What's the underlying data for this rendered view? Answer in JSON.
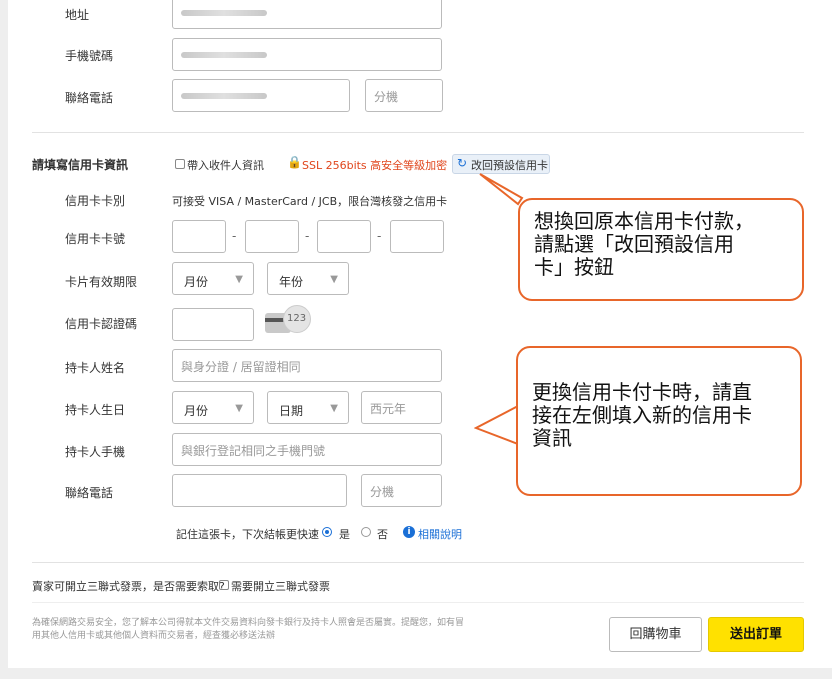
{
  "recipient": {
    "address_label": "地址",
    "mobile_label": "手機號碼",
    "phone_label": "聯絡電話",
    "extension_placeholder": "分機"
  },
  "card": {
    "section_title": "請填寫信用卡資訊",
    "import_recipient_label": "帶入收件人資訊",
    "ssl_label": "SSL 256bits 高安全等級加密",
    "restore_default_label": "改回預設信用卡",
    "type_label": "信用卡卡別",
    "type_value": "可接受 VISA / MasterCard / JCB，限台灣核發之信用卡",
    "number_label": "信用卡卡號",
    "expiry_label": "卡片有效期限",
    "month_option": "月份",
    "year_option": "年份",
    "cvv_label": "信用卡認證碼",
    "cvv_icon_text": "123",
    "holder_name_label": "持卡人姓名",
    "holder_name_placeholder": "與身分證 / 居留證相同",
    "birthday_label": "持卡人生日",
    "day_option": "日期",
    "roc_year_placeholder": "西元年",
    "holder_mobile_label": "持卡人手機",
    "holder_mobile_placeholder": "與銀行登記相同之手機門號",
    "contact_phone_label": "聯絡電話",
    "extension_placeholder": "分機",
    "remember_label": "記住這張卡，下次結帳更快速",
    "remember_yes": "是",
    "remember_no": "否",
    "help_link": "相關說明"
  },
  "invoice": {
    "question": "賣家可開立三聯式發票，是否需要索取?",
    "option_label": "需要開立三聯式發票"
  },
  "disclaimer": {
    "line1": "為確保網路交易安全，您了解本公司得就本文件交易資料向發卡銀行及持卡人照會是否屬實。提醒您，如有冒",
    "line2": "用其他人信用卡或其他個人資料而交易者，經查獲必移送法辦"
  },
  "buttons": {
    "back_to_cart": "回購物車",
    "submit_order": "送出訂單"
  },
  "callouts": {
    "restore_card": [
      "想換回原本信用卡付款，",
      "請點選「改回預設信用",
      "卡」按鈕"
    ],
    "new_card": [
      "更換信用卡付卡時，請直",
      "接在左側填入新的信用卡",
      "資訊"
    ]
  },
  "colors": {
    "submit": "#ffe100",
    "ssl_text": "#e0451b",
    "callout_border": "#e8662a",
    "link": "#1a6fd6"
  }
}
